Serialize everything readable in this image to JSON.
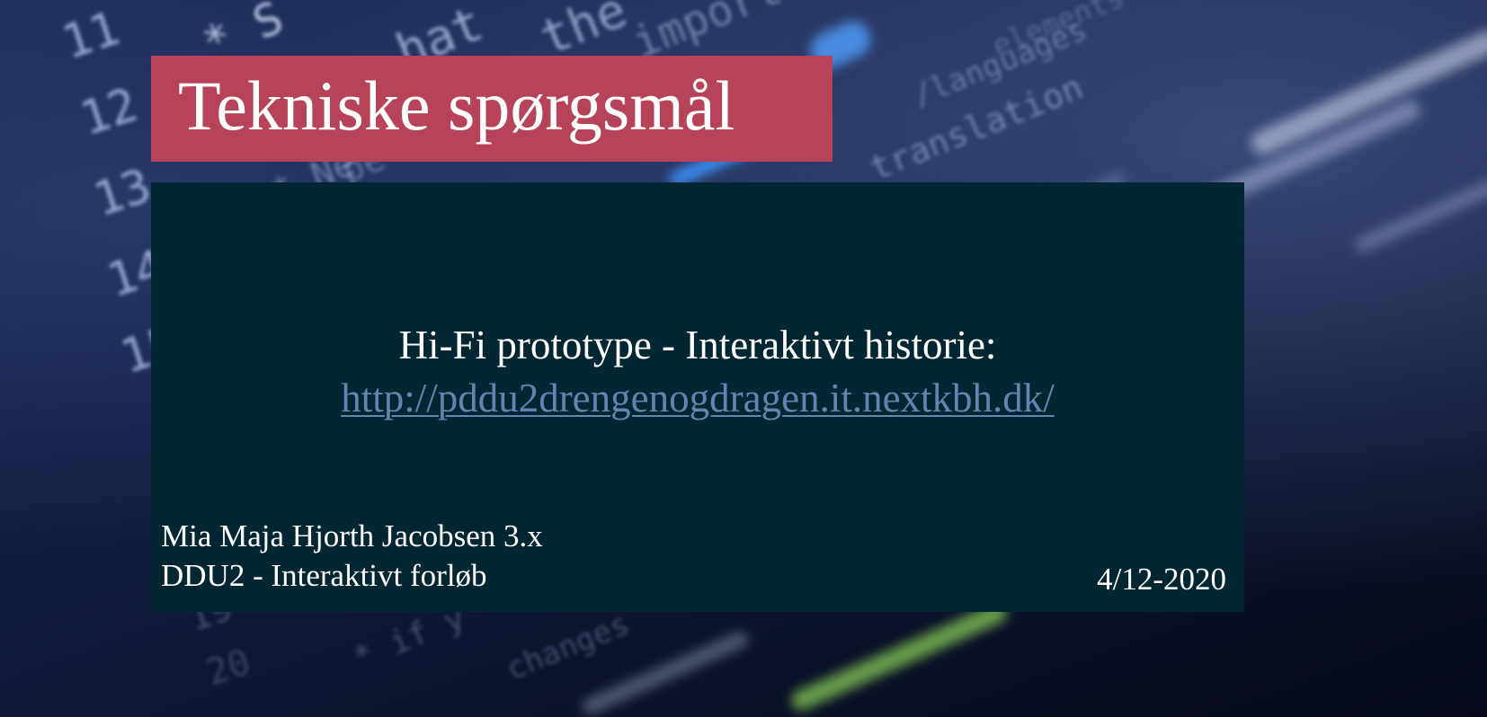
{
  "slide": {
    "title": "Tekniske spørgsmål",
    "subtitle": "Hi-Fi prototype - Interaktivt historie:",
    "link": "http://pddu2drengenogdragen.it.nextkbh.dk/",
    "author_line": "Mia Maja Hjorth Jacobsen 3.x",
    "course_line": "DDU2 - Interaktivt forløb",
    "date": "4/12-2020"
  },
  "colors": {
    "title_background": "#b6435a",
    "content_background": "#022732",
    "link": "#5f86b0",
    "text": "#ffffff"
  }
}
